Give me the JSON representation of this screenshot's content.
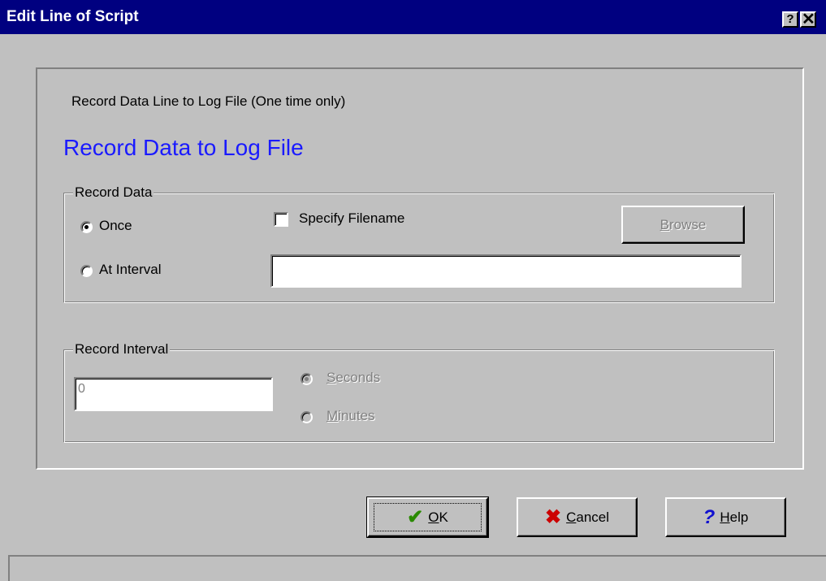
{
  "window": {
    "title": "Edit Line of Script",
    "help_glyph": "?",
    "close_glyph": "✕"
  },
  "description": "Record Data Line to Log File (One time only)",
  "heading": "Record Data to Log File",
  "colors": {
    "heading": "#1a1aff",
    "titlebar": "#000080",
    "face": "#c0c0c0"
  },
  "record_data": {
    "legend": "Record Data",
    "once_label": "Once",
    "interval_label": "At Interval",
    "selected": "Once",
    "specify_filename_label": "Specify Filename",
    "specify_filename_checked": false,
    "browse": {
      "pre": "",
      "hotkey": "B",
      "post": "rowse"
    },
    "filename_value": ""
  },
  "record_interval": {
    "legend": "Record Interval",
    "value": "0",
    "seconds": {
      "hotkey": "S",
      "post": "econds"
    },
    "minutes": {
      "hotkey": "M",
      "post": "inutes"
    },
    "selected": "Seconds"
  },
  "buttons": {
    "ok": {
      "hotkey": "O",
      "post": "K",
      "icon": "checkmark-icon"
    },
    "cancel": {
      "hotkey": "C",
      "post": "ancel",
      "icon": "x-icon"
    },
    "help": {
      "hotkey": "H",
      "post": "elp",
      "icon": "question-icon"
    }
  }
}
